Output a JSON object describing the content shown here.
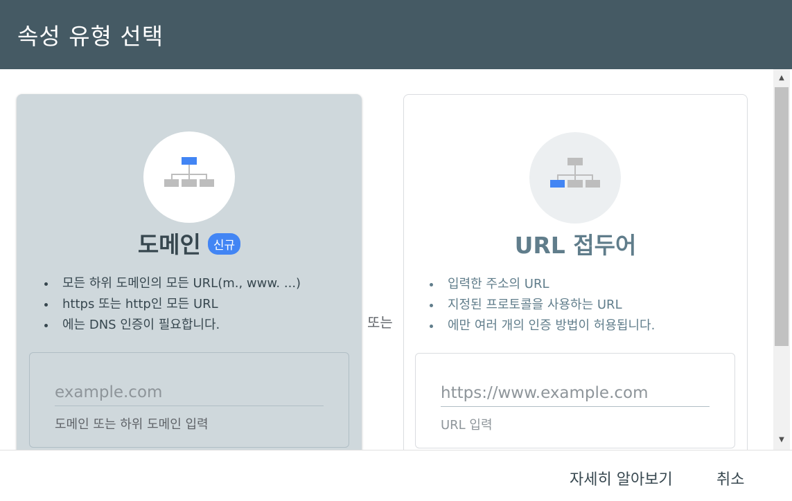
{
  "dialog": {
    "title": "속성 유형 선택"
  },
  "domain_card": {
    "icon": "sitemap-icon",
    "title": "도메인",
    "badge": "신규",
    "features": [
      "모든 하위 도메인의 모든 URL(m., www. ...)",
      "https 또는 http인 모든 URL",
      "에는 DNS 인증이 필요합니다."
    ],
    "input_placeholder": "example.com",
    "input_help": "도메인 또는 하위 도메인 입력"
  },
  "or_label": "또는",
  "url_card": {
    "icon": "sitemap-icon",
    "title": "URL 접두어",
    "features": [
      "입력한 주소의 URL",
      "지정된 프로토콜을 사용하는 URL",
      "에만 여러 개의 인증 방법이 허용됩니다."
    ],
    "input_placeholder": "https://www.example.com",
    "input_help": "URL 입력"
  },
  "footer": {
    "learn_more": "자세히 알아보기",
    "cancel": "취소"
  },
  "colors": {
    "header_bg": "#455a64",
    "selected_card_bg": "#cfd8dc",
    "accent_blue": "#4285f4",
    "node_gray": "#bdbdbd"
  }
}
